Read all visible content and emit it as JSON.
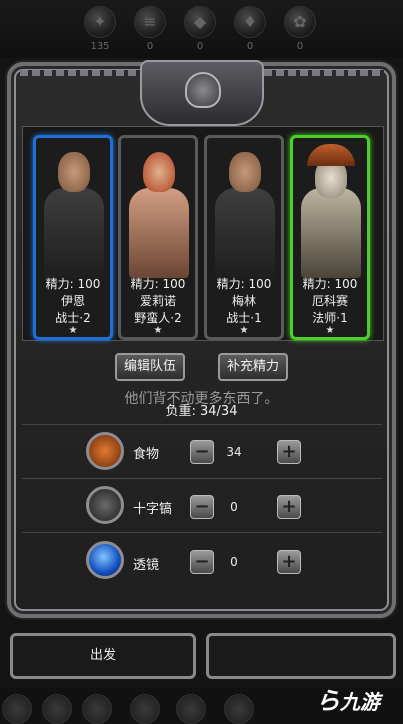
{
  "resources": [
    {
      "icon": "meat-icon",
      "count": "135"
    },
    {
      "icon": "wood-icon",
      "count": "0"
    },
    {
      "icon": "stone-icon",
      "count": "0"
    },
    {
      "icon": "crystal-icon",
      "count": "0"
    },
    {
      "icon": "gear-ore-icon",
      "count": "0"
    }
  ],
  "heroes": [
    {
      "stamina": "精力: 100",
      "name": "伊恩",
      "class": "战士·2",
      "star": "★",
      "frame": "blue"
    },
    {
      "stamina": "精力: 100",
      "name": "爱莉诺",
      "class": "野蛮人·2",
      "star": "★",
      "frame": "gray"
    },
    {
      "stamina": "精力: 100",
      "name": "梅林",
      "class": "战士·1",
      "star": "★",
      "frame": "gray"
    },
    {
      "stamina": "精力: 100",
      "name": "厄科赛",
      "class": "法师·1",
      "star": "★",
      "frame": "green"
    }
  ],
  "buttons": {
    "edit_team": "编辑队伍",
    "replenish": "补充精力"
  },
  "toast": "他们背不动更多东西了。",
  "load": "负重: 34/34",
  "supplies": [
    {
      "label": "食物",
      "value": "34",
      "icon": "food-icon"
    },
    {
      "label": "十字镐",
      "value": "0",
      "icon": "pickaxe-icon"
    },
    {
      "label": "透镜",
      "value": "0",
      "icon": "lens-icon"
    }
  ],
  "controls": {
    "minus": "−",
    "plus": "+"
  },
  "depart": "出发",
  "watermark": "九游"
}
